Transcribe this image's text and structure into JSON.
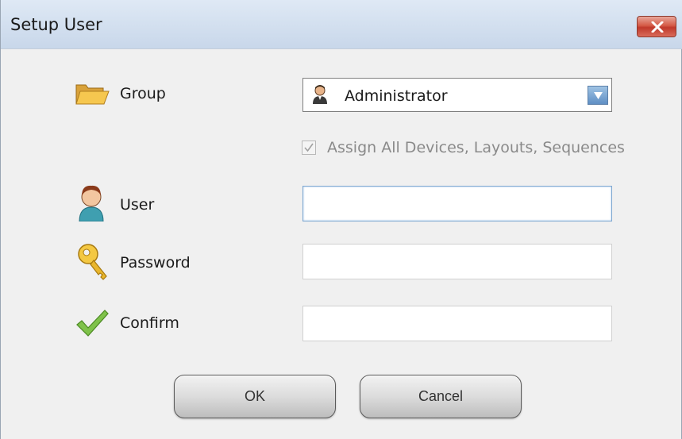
{
  "window": {
    "title": "Setup User"
  },
  "form": {
    "group_label": "Group",
    "group_selected": "Administrator",
    "assign_all_label": "Assign All Devices, Layouts, Sequences",
    "assign_all_checked": true,
    "assign_all_enabled": false,
    "user_label": "User",
    "user_value": "",
    "password_label": "Password",
    "password_value": "",
    "confirm_label": "Confirm",
    "confirm_value": ""
  },
  "buttons": {
    "ok_label": "OK",
    "cancel_label": "Cancel"
  },
  "icons": {
    "group": "folder-icon",
    "group_value": "person-icon",
    "user": "user-avatar-icon",
    "password": "key-icon",
    "confirm": "checkmark-icon",
    "dropdown": "chevron-down-icon",
    "close": "close-icon"
  },
  "colors": {
    "close_button": "#c0392b",
    "dropdown_arrow": "#5f8fc4",
    "titlebar": "#c8d7ea"
  }
}
